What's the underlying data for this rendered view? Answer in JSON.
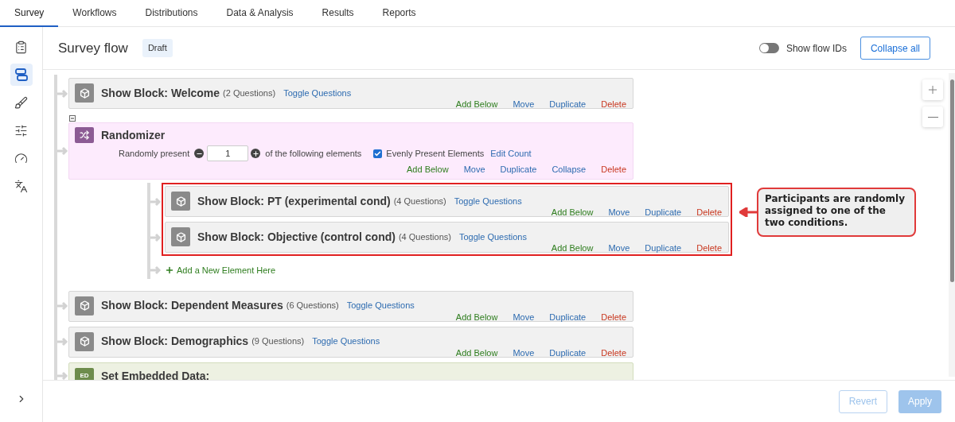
{
  "top_tabs": [
    {
      "label": "Survey",
      "selected": true
    },
    {
      "label": "Workflows",
      "selected": false
    },
    {
      "label": "Distributions",
      "selected": false
    },
    {
      "label": "Data & Analysis",
      "selected": false
    },
    {
      "label": "Results",
      "selected": false
    },
    {
      "label": "Reports",
      "selected": false
    }
  ],
  "sidebar": {
    "items": [
      {
        "selected": false
      },
      {
        "selected": true
      },
      {
        "selected": false
      },
      {
        "selected": false
      },
      {
        "selected": false
      },
      {
        "selected": false
      }
    ]
  },
  "header": {
    "title": "Survey flow",
    "badge": "Draft",
    "toggle": {
      "label": "Show flow IDs",
      "on": false
    },
    "collapse_button": "Collapse all"
  },
  "flow": {
    "elements": [
      {
        "kind": "block",
        "title": "Show Block: Welcome",
        "count": "(2 Questions)",
        "toggle_link": "Toggle Questions",
        "actions": [
          {
            "kind": "add",
            "label": "Add Below"
          },
          {
            "kind": "move",
            "label": "Move"
          },
          {
            "kind": "duplicate",
            "label": "Duplicate"
          },
          {
            "kind": "delete",
            "label": "Delete"
          }
        ]
      },
      {
        "kind": "randomizer",
        "title": "Randomizer",
        "prefix": "Randomly present",
        "value": "1",
        "suffix": "of the following elements",
        "evenly": {
          "label": "Evenly Present Elements",
          "checked": true
        },
        "edit_link": "Edit Count",
        "actions": [
          {
            "kind": "add",
            "label": "Add Below"
          },
          {
            "kind": "move",
            "label": "Move"
          },
          {
            "kind": "duplicate",
            "label": "Duplicate"
          },
          {
            "kind": "collapse",
            "label": "Collapse"
          },
          {
            "kind": "delete",
            "label": "Delete"
          }
        ],
        "highlighted": true,
        "children": [
          {
            "kind": "block",
            "title": "Show Block: PT (experimental cond)",
            "count": "(4 Questions)",
            "toggle_link": "Toggle Questions",
            "actions": [
              {
                "kind": "add",
                "label": "Add Below"
              },
              {
                "kind": "move",
                "label": "Move"
              },
              {
                "kind": "duplicate",
                "label": "Duplicate"
              },
              {
                "kind": "delete",
                "label": "Delete"
              }
            ]
          },
          {
            "kind": "block",
            "title": "Show Block: Objective (control cond)",
            "count": "(4 Questions)",
            "toggle_link": "Toggle Questions",
            "actions": [
              {
                "kind": "add",
                "label": "Add Below"
              },
              {
                "kind": "move",
                "label": "Move"
              },
              {
                "kind": "duplicate",
                "label": "Duplicate"
              },
              {
                "kind": "delete",
                "label": "Delete"
              }
            ]
          }
        ],
        "add_element": "Add a New Element Here"
      },
      {
        "kind": "block",
        "title": "Show Block: Dependent Measures",
        "count": "(6 Questions)",
        "toggle_link": "Toggle Questions",
        "actions": [
          {
            "kind": "add",
            "label": "Add Below"
          },
          {
            "kind": "move",
            "label": "Move"
          },
          {
            "kind": "duplicate",
            "label": "Duplicate"
          },
          {
            "kind": "delete",
            "label": "Delete"
          }
        ]
      },
      {
        "kind": "block",
        "title": "Show Block: Demographics",
        "count": "(9 Questions)",
        "toggle_link": "Toggle Questions",
        "actions": [
          {
            "kind": "add",
            "label": "Add Below"
          },
          {
            "kind": "move",
            "label": "Move"
          },
          {
            "kind": "duplicate",
            "label": "Duplicate"
          },
          {
            "kind": "delete",
            "label": "Delete"
          }
        ]
      },
      {
        "kind": "embedded",
        "title": "Set Embedded Data:",
        "icon_text": "ED"
      }
    ]
  },
  "annotation": {
    "text": "Participants are randomly assigned to one of the two conditions."
  },
  "footer": {
    "buttons": [
      {
        "kind": "secondary",
        "label": "Revert",
        "disabled": true
      },
      {
        "kind": "primary",
        "label": "Apply",
        "disabled": true
      }
    ]
  }
}
